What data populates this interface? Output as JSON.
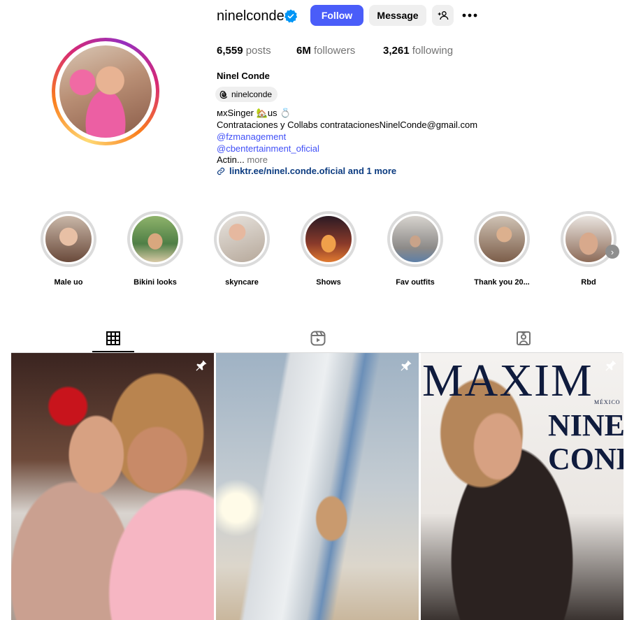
{
  "header": {
    "username": "ninelconde",
    "follow_label": "Follow",
    "message_label": "Message"
  },
  "stats": {
    "posts_count": "6,559",
    "posts_label": "posts",
    "followers_count": "6M",
    "followers_label": "followers",
    "following_count": "3,261",
    "following_label": "following"
  },
  "profile": {
    "full_name": "Ninel Conde",
    "threads_handle": "ninelconde",
    "bio": {
      "line1": "ᴍxSinger 🏡us 💍",
      "line2": "Contrataciones y Collabs contratacionesNinelConde@gmail.com",
      "mention1": "@fzmanagement",
      "mention2": "@cbentertainment_oficial",
      "truncated": "Actin...",
      "more": "more"
    },
    "external_link": "linktr.ee/ninel.conde.oficial and 1 more"
  },
  "highlights": [
    {
      "label": "Male uo"
    },
    {
      "label": "Bikini looks"
    },
    {
      "label": "skyncare"
    },
    {
      "label": "Shows"
    },
    {
      "label": "Fav outfits"
    },
    {
      "label": "Thank you 20..."
    },
    {
      "label": "Rbd"
    }
  ],
  "tabs": {
    "active": "posts",
    "items": [
      "posts-grid-icon",
      "reels-icon",
      "tagged-icon"
    ]
  },
  "posts": {
    "cover_title": "MAXIM",
    "cover_country": "MÉXICO",
    "cover_name_line1": "NINEL",
    "cover_name_line2": "CONDE"
  },
  "colors": {
    "follow_button": "#4a5df9",
    "link_blue": "#4150f7",
    "verified_blue": "#0095f6"
  }
}
